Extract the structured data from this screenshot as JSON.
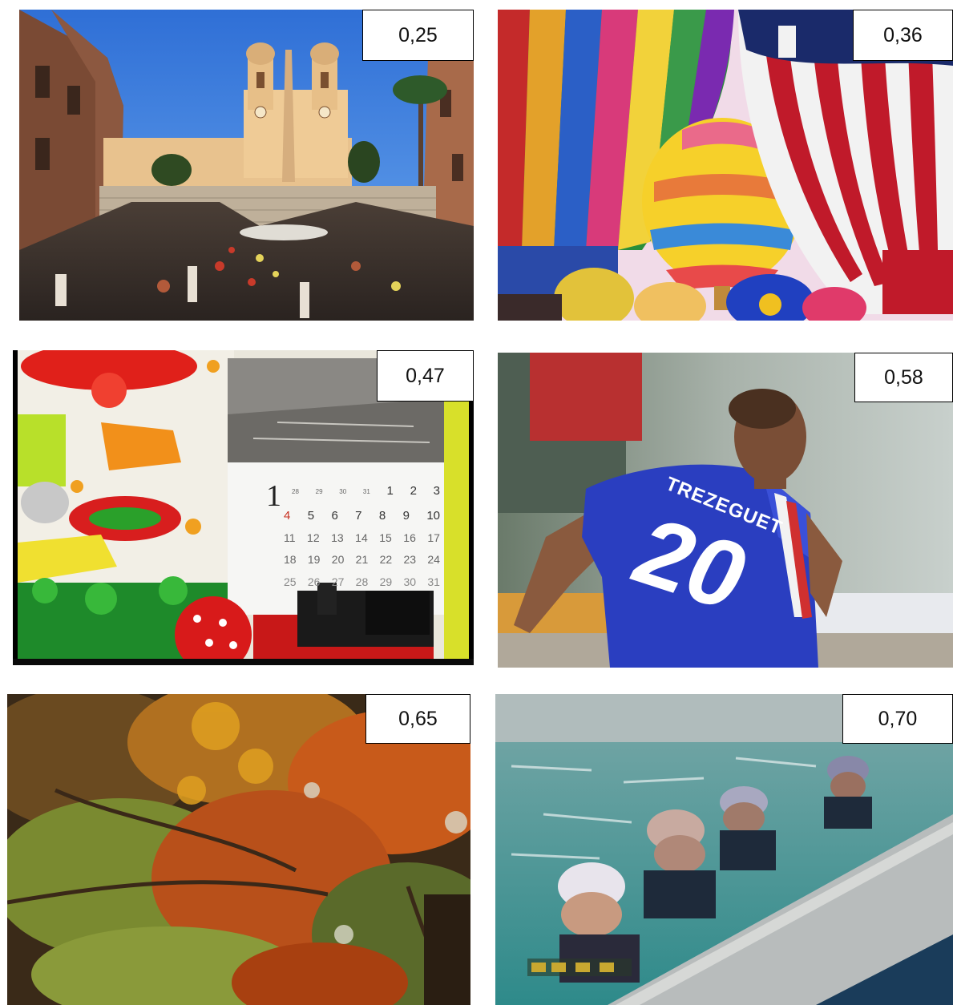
{
  "grid": [
    {
      "id": "rome-steps",
      "score": "0,25"
    },
    {
      "id": "hot-air-balloons",
      "score": "0,36"
    },
    {
      "id": "calendar-toys",
      "score": "0,47"
    },
    {
      "id": "football-player",
      "score": "0,58"
    },
    {
      "id": "autumn-tree",
      "score": "0,65"
    },
    {
      "id": "swimmers-pool",
      "score": "0,70"
    }
  ],
  "calendar": {
    "month_number": "1",
    "header_row": [
      "28",
      "29",
      "30",
      "31",
      "1",
      "2",
      "3"
    ],
    "rows": [
      [
        "4",
        "5",
        "6",
        "7",
        "8",
        "9",
        "10"
      ],
      [
        "11",
        "12",
        "13",
        "14",
        "15",
        "16",
        "17"
      ],
      [
        "18",
        "19",
        "20",
        "21",
        "22",
        "23",
        "24"
      ],
      [
        "25",
        "26",
        "27",
        "28",
        "29",
        "30",
        "31"
      ]
    ]
  },
  "jersey": {
    "name": "TREZEGUET",
    "number": "20"
  }
}
